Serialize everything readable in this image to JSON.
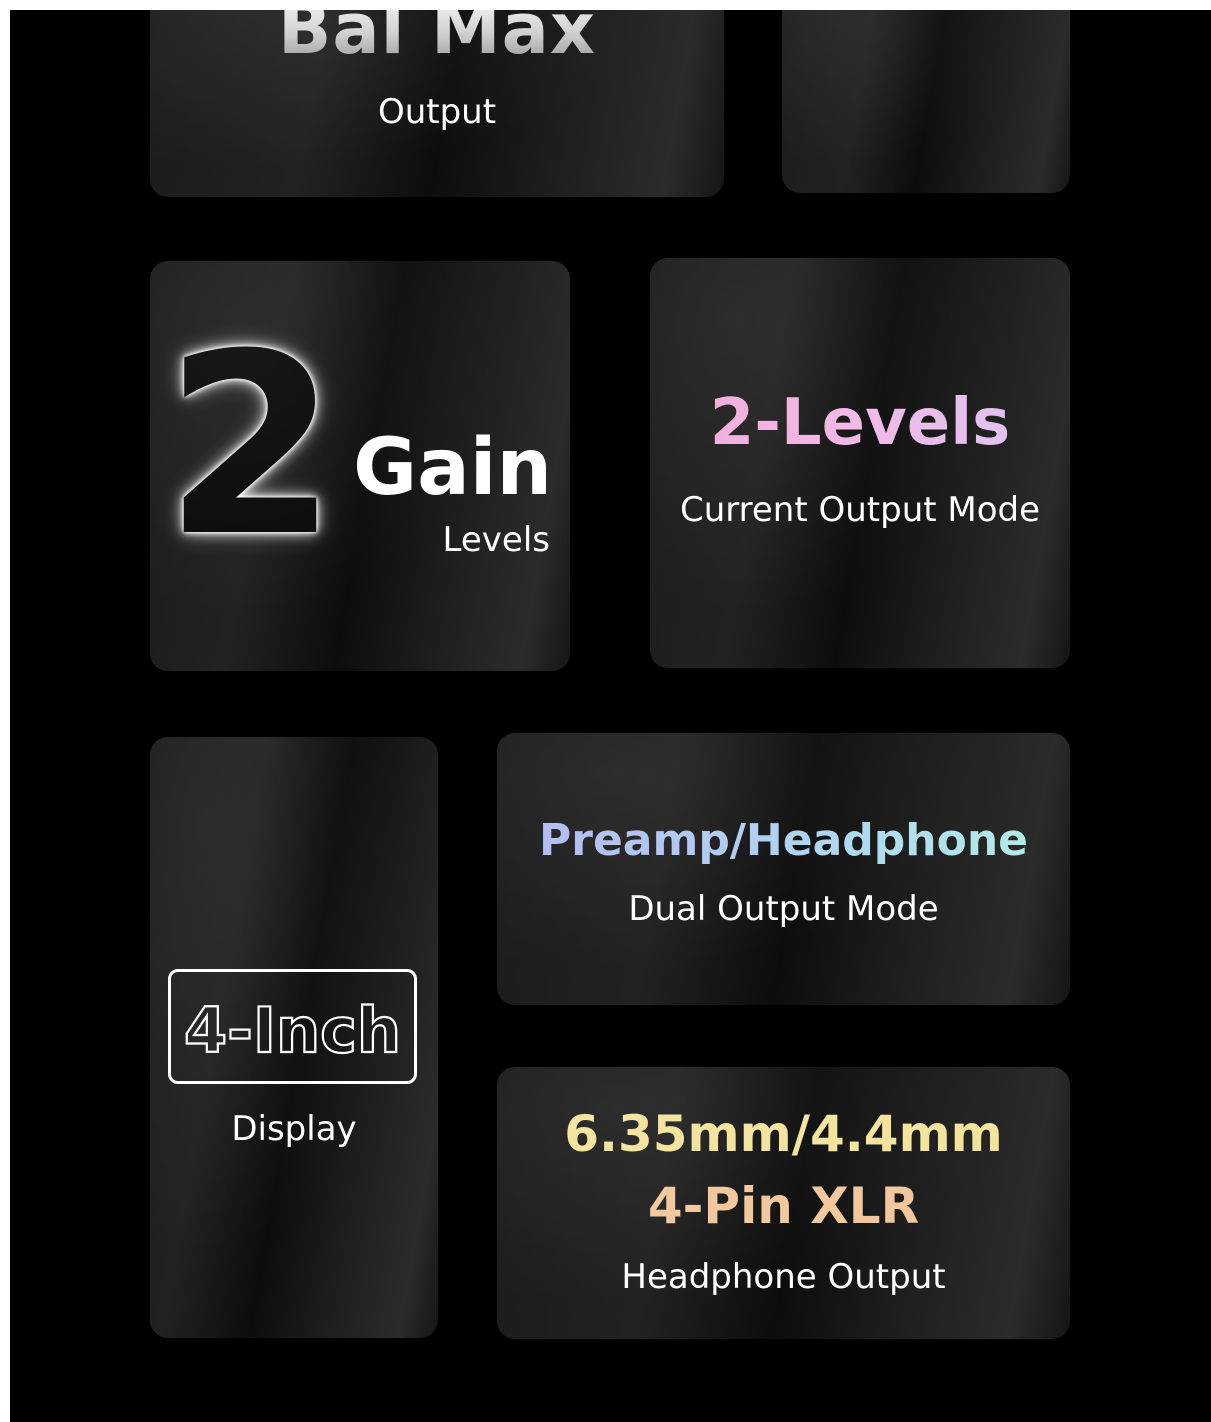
{
  "cards": {
    "bal_max": {
      "title": "Bal Max",
      "subtitle": "Output"
    },
    "gain": {
      "number": "2",
      "title": "Gain",
      "subtitle": "Levels"
    },
    "current_mode": {
      "title": "2-Levels",
      "subtitle": "Current Output Mode"
    },
    "display": {
      "title": "4-Inch",
      "subtitle": "Display"
    },
    "dual_mode": {
      "title": "Preamp/Headphone",
      "subtitle": "Dual Output Mode"
    },
    "headphone_output": {
      "line1": "6.35mm/4.4mm",
      "line2": "4-Pin XLR",
      "subtitle": "Headphone Output"
    }
  },
  "colors": {
    "background": "#000000",
    "current_mode_title": "#f2b8e6",
    "dual_mode_title": "#aed4f0",
    "headphone_line1": "#f4e39b",
    "headphone_line2": "#f2c79c"
  }
}
